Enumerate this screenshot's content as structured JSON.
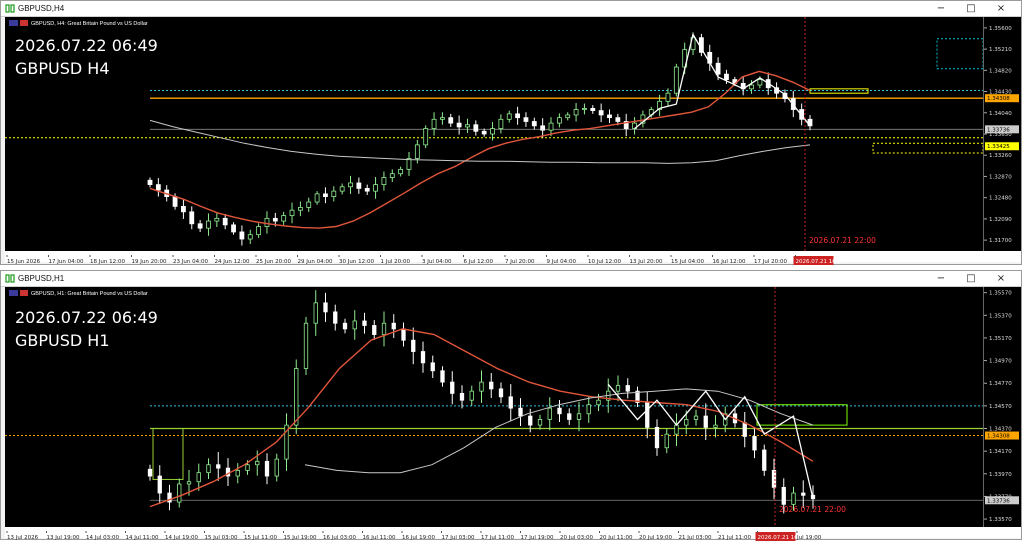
{
  "window1": {
    "title": "GBPUSD,H4",
    "header": "GBPUSD, H4:  Great Britain Pound vs US Dollar",
    "overlay_line1": "2026.07.22 06:49",
    "overlay_line2": "GBPUSD H4",
    "vline_label": "2026.07.21 22:00",
    "xaxis_labels": [
      "15 Jun 2026",
      "17 Jun 04:00",
      "18 Jun 12:00",
      "19 Jun 20:00",
      "23 Jun 04:00",
      "24 Jun 12:00",
      "25 Jun 20:00",
      "29 Jun 04:00",
      "30 Jun 12:00",
      "1 Jul 20:00",
      "3 Jul 04:00",
      "6 Jul 12:00",
      "7 Jul 20:00",
      "9 Jul 04:00",
      "10 Jul 12:00",
      "13 Jul 20:00",
      "15 Jul 04:00",
      "16 Jul 12:00",
      "17 Jul 20:00",
      "2026.07.21 16:00"
    ],
    "yaxis_labels": [
      "1.35600",
      "1.35210",
      "1.34820",
      "1.34430",
      "1.34040",
      "1.33650",
      "1.33260",
      "1.32870",
      "1.32480",
      "1.32090",
      "1.31700"
    ],
    "price_tags": [
      {
        "text": "1.34308",
        "color": "#ffa500"
      },
      {
        "text": "1.33736",
        "color": "#cccccc"
      },
      {
        "text": "1.33425",
        "color": "#ffff00"
      }
    ]
  },
  "window2": {
    "title": "GBPUSD,H1",
    "header": "GBPUSD, H1:  Great Britain Pound vs US Dollar",
    "overlay_line1": "2026.07.22 06:49",
    "overlay_line2": "GBPUSD H1",
    "vline_label": "2026.07.21 22:00",
    "xaxis_labels": [
      "13 Jul 2026",
      "13 Jul 19:00",
      "14 Jul 03:00",
      "14 Jul 11:00",
      "14 Jul 19:00",
      "15 Jul 03:00",
      "15 Jul 11:00",
      "15 Jul 19:00",
      "16 Jul 03:00",
      "16 Jul 11:00",
      "16 Jul 19:00",
      "17 Jul 03:00",
      "17 Jul 11:00",
      "17 Jul 19:00",
      "20 Jul 03:00",
      "20 Jul 11:00",
      "20 Jul 19:00",
      "21 Jul 03:00",
      "21 Jul 11:00",
      "2026.07.21 16:00",
      "Jul 19:00"
    ],
    "yaxis_labels": [
      "1.35570",
      "1.35370",
      "1.35170",
      "1.34970",
      "1.34770",
      "1.34570",
      "1.34370",
      "1.34170",
      "1.33970",
      "1.33770",
      "1.33570"
    ],
    "price_tags": [
      {
        "text": "1.34308",
        "color": "#ffa500"
      },
      {
        "text": "1.33736",
        "color": "#cccccc"
      },
      {
        "text": "1.33425",
        "color": "#ffff00"
      }
    ]
  },
  "controls": {
    "minimize": "−",
    "maximize": "□",
    "close": "×"
  },
  "colors": {
    "bull": "#90ee90",
    "bear": "#ffffff",
    "ma_red": "#e0553a",
    "ma_white": "#c8c8c8",
    "orange": "#ffa500",
    "yellow": "#ffff00",
    "cyan": "#00bcd4",
    "green": "#7cfc00",
    "redline": "#cc2222"
  },
  "chart_data": [
    {
      "type": "candlestick",
      "title": "GBPUSD, H4:  Great Britain Pound vs US Dollar",
      "xlabel": "",
      "ylabel": "",
      "ylim": [
        1.315,
        1.358
      ],
      "series": [
        {
          "values": [
            1.3272,
            1.3262,
            1.325,
            1.3232,
            1.3222,
            1.32,
            1.3192,
            1.3205,
            1.321,
            1.3198,
            1.3185,
            1.3172,
            1.318,
            1.3195,
            1.321,
            1.3205,
            1.3215,
            1.3225,
            1.323,
            1.324,
            1.3255,
            1.325,
            1.326,
            1.3268,
            1.3275,
            1.3265,
            1.326,
            1.3272,
            1.3285,
            1.3292,
            1.33,
            1.332,
            1.3345,
            1.3375,
            1.3392,
            1.3395,
            1.3385,
            1.3378,
            1.3382,
            1.337,
            1.3365,
            1.3375,
            1.3392,
            1.3402,
            1.3395,
            1.3388,
            1.338,
            1.3372,
            1.3385,
            1.3395,
            1.34,
            1.341,
            1.3412,
            1.3408,
            1.34,
            1.3395,
            1.3388,
            1.3375,
            1.3385,
            1.34,
            1.341,
            1.3425,
            1.344,
            1.3488,
            1.352,
            1.3542,
            1.3515,
            1.3495,
            1.3475,
            1.3465,
            1.3458,
            1.3448,
            1.3455,
            1.3465,
            1.345,
            1.344,
            1.343,
            1.341,
            1.3392,
            1.338
          ]
        }
      ],
      "moving_averages": [
        {
          "values": [
            1.3265,
            1.3255,
            1.3245,
            1.3232,
            1.322,
            1.3212,
            1.3205,
            1.32,
            1.3196,
            1.3193,
            1.3192,
            1.3195,
            1.3205,
            1.322,
            1.3238,
            1.3256,
            1.3275,
            1.3292,
            1.3305,
            1.3322,
            1.3338,
            1.3348,
            1.3355,
            1.336,
            1.3367,
            1.3372,
            1.3375,
            1.338,
            1.3385,
            1.339,
            1.3395,
            1.34,
            1.3405,
            1.3415,
            1.344,
            1.347,
            1.348,
            1.3472,
            1.346,
            1.3445
          ]
        },
        {
          "values": [
            1.339,
            1.3378,
            1.3368,
            1.3358,
            1.3348,
            1.334,
            1.3333,
            1.3328,
            1.3324,
            1.3322,
            1.332,
            1.3318,
            1.3317,
            1.3316,
            1.3315,
            1.3315,
            1.3314,
            1.3313,
            1.3313,
            1.3312,
            1.3312,
            1.3312,
            1.3311,
            1.3312,
            1.3316,
            1.3325,
            1.3333,
            1.334,
            1.3345
          ]
        }
      ]
    },
    {
      "type": "candlestick",
      "title": "GBPUSD, H1:  Great Britain Pound vs US Dollar",
      "xlabel": "",
      "ylabel": "",
      "ylim": [
        1.335,
        1.3562
      ],
      "series": [
        {
          "values": [
            1.3395,
            1.338,
            1.3372,
            1.3388,
            1.339,
            1.3398,
            1.3405,
            1.3402,
            1.3395,
            1.34,
            1.3405,
            1.3408,
            1.3395,
            1.341,
            1.344,
            1.349,
            1.353,
            1.3548,
            1.354,
            1.353,
            1.3525,
            1.3532,
            1.3528,
            1.352,
            1.353,
            1.3525,
            1.3515,
            1.3505,
            1.3495,
            1.3488,
            1.3478,
            1.3468,
            1.3462,
            1.347,
            1.3478,
            1.3472,
            1.3465,
            1.3455,
            1.3448,
            1.344,
            1.3445,
            1.3455,
            1.345,
            1.3445,
            1.345,
            1.3458,
            1.3462,
            1.347,
            1.3475,
            1.347,
            1.346,
            1.3438,
            1.342,
            1.3432,
            1.344,
            1.3445,
            1.3448,
            1.3438,
            1.344,
            1.345,
            1.3442,
            1.343,
            1.3418,
            1.34,
            1.3385,
            1.337,
            1.338,
            1.3378,
            1.3375
          ]
        }
      ],
      "moving_averages": [
        {
          "values": [
            1.3368,
            1.3378,
            1.339,
            1.3405,
            1.3425,
            1.3455,
            1.349,
            1.3515,
            1.3525,
            1.352,
            1.3505,
            1.349,
            1.3478,
            1.347,
            1.3465,
            1.3462,
            1.346,
            1.3458,
            1.3452,
            1.344,
            1.3425,
            1.3408
          ]
        },
        {
          "values": [
            1.3405,
            1.34,
            1.3398,
            1.3398,
            1.3405,
            1.342,
            1.3438,
            1.345,
            1.3458,
            1.3464,
            1.3468,
            1.347,
            1.3472,
            1.347,
            1.3462,
            1.345,
            1.344
          ]
        }
      ]
    }
  ]
}
